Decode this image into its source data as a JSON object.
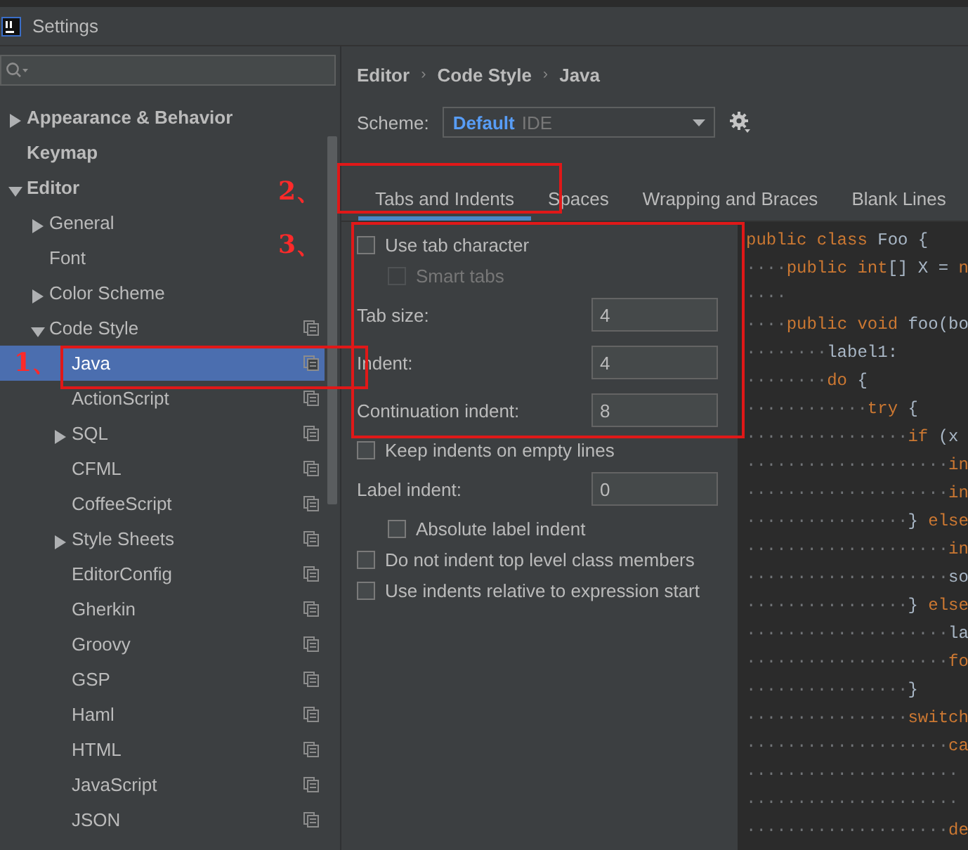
{
  "window": {
    "title": "Settings"
  },
  "sidebar": {
    "items": [
      {
        "label": "Appearance & Behavior",
        "expanded": false
      },
      {
        "label": "Keymap"
      },
      {
        "label": "Editor",
        "expanded": true,
        "children": [
          {
            "label": "General",
            "expanded": false
          },
          {
            "label": "Font"
          },
          {
            "label": "Color Scheme",
            "expanded": false
          },
          {
            "label": "Code Style",
            "expanded": true,
            "scheme_icon": true,
            "children": [
              {
                "label": "Java",
                "selected": true,
                "scheme_icon": true
              },
              {
                "label": "ActionScript",
                "selected": false,
                "scheme_icon": true
              },
              {
                "label": "SQL",
                "selected": false,
                "expanded": false,
                "scheme_icon": true
              },
              {
                "label": "CFML",
                "selected": false,
                "scheme_icon": true
              },
              {
                "label": "CoffeeScript",
                "selected": false,
                "scheme_icon": true
              },
              {
                "label": "Style Sheets",
                "selected": false,
                "expanded": false,
                "scheme_icon": true
              },
              {
                "label": "EditorConfig",
                "selected": false,
                "scheme_icon": true
              },
              {
                "label": "Gherkin",
                "selected": false,
                "scheme_icon": true
              },
              {
                "label": "Groovy",
                "selected": false,
                "scheme_icon": true
              },
              {
                "label": "GSP",
                "selected": false,
                "scheme_icon": true
              },
              {
                "label": "Haml",
                "selected": false,
                "scheme_icon": true
              },
              {
                "label": "HTML",
                "selected": false,
                "scheme_icon": true
              },
              {
                "label": "JavaScript",
                "selected": false,
                "scheme_icon": true
              },
              {
                "label": "JSON",
                "selected": false,
                "scheme_icon": true
              }
            ]
          }
        ]
      }
    ]
  },
  "breadcrumb": [
    {
      "text": "Editor",
      "kind": "crumb"
    },
    {
      "text": "›",
      "kind": "separator"
    },
    {
      "text": "Code Style",
      "kind": "crumb"
    },
    {
      "text": "›",
      "kind": "separator"
    },
    {
      "text": "Java",
      "kind": "crumb"
    }
  ],
  "scheme": {
    "label": "Scheme:",
    "value": "Default",
    "suffix": "IDE"
  },
  "tabs": [
    {
      "label": "Tabs and Indents",
      "selected": true
    },
    {
      "label": "Spaces",
      "selected": false
    },
    {
      "label": "Wrapping and Braces",
      "selected": false
    },
    {
      "label": "Blank Lines",
      "selected": false
    }
  ],
  "options": [
    {
      "kind": "checkbox",
      "label": "Use tab character",
      "checked": false,
      "disabled": false
    },
    {
      "kind": "subcheckbox",
      "label": "Smart tabs",
      "checked": false,
      "disabled": true
    },
    {
      "kind": "number",
      "label": "Tab size:",
      "value": "4"
    },
    {
      "kind": "number",
      "label": "Indent:",
      "value": "4"
    },
    {
      "kind": "number",
      "label": "Continuation indent:",
      "value": "8"
    },
    {
      "kind": "checkbox",
      "label": "Keep indents on empty lines",
      "checked": false,
      "disabled": false
    },
    {
      "kind": "number",
      "label": "Label indent:",
      "value": "0"
    },
    {
      "kind": "subcheckbox",
      "label": "Absolute label indent",
      "checked": false,
      "disabled": false
    },
    {
      "kind": "checkbox",
      "label": "Do not indent top level class members",
      "checked": false,
      "disabled": false
    },
    {
      "kind": "checkbox",
      "label": "Use indents relative to expression start",
      "checked": false,
      "disabled": false
    }
  ],
  "code_lines": [
    {
      "tokens": [
        {
          "text": "public class ",
          "kind": "keyword"
        },
        {
          "text": "Foo {",
          "kind": "plain"
        }
      ]
    },
    {
      "indent": "····",
      "tokens": [
        {
          "text": "public int",
          "kind": "keyword"
        },
        {
          "text": "[] X = ",
          "kind": "plain"
        },
        {
          "text": "n",
          "kind": "keyword"
        }
      ]
    },
    {
      "indent": "····"
    },
    {
      "indent": "····",
      "tokens": [
        {
          "text": "public void ",
          "kind": "keyword"
        },
        {
          "text": "foo(bo",
          "kind": "plain"
        }
      ]
    },
    {
      "indent": "········",
      "tokens": [
        {
          "text": "label1:",
          "kind": "plain"
        }
      ]
    },
    {
      "indent": "········",
      "tokens": [
        {
          "text": "do ",
          "kind": "keyword"
        },
        {
          "text": "{",
          "kind": "plain"
        }
      ]
    },
    {
      "indent": "············",
      "tokens": [
        {
          "text": "try ",
          "kind": "keyword"
        },
        {
          "text": "{",
          "kind": "plain"
        }
      ]
    },
    {
      "indent": "················",
      "tokens": [
        {
          "text": "if ",
          "kind": "keyword"
        },
        {
          "text": "(x",
          "kind": "plain"
        }
      ]
    },
    {
      "indent": "····················",
      "tokens": [
        {
          "text": "in",
          "kind": "keyword"
        }
      ]
    },
    {
      "indent": "····················",
      "tokens": [
        {
          "text": "in",
          "kind": "keyword"
        }
      ]
    },
    {
      "indent": "················",
      "tokens": [
        {
          "text": "} ",
          "kind": "plain"
        },
        {
          "text": "else",
          "kind": "keyword"
        }
      ]
    },
    {
      "indent": "····················",
      "tokens": [
        {
          "text": "in",
          "kind": "keyword"
        }
      ]
    },
    {
      "indent": "····················",
      "tokens": [
        {
          "text": "so",
          "kind": "plain"
        }
      ]
    },
    {
      "indent": "················",
      "tokens": [
        {
          "text": "} ",
          "kind": "plain"
        },
        {
          "text": "else",
          "kind": "keyword"
        }
      ]
    },
    {
      "indent": "····················",
      "tokens": [
        {
          "text": "la",
          "kind": "plain"
        }
      ]
    },
    {
      "indent": "····················",
      "tokens": [
        {
          "text": "fo",
          "kind": "keyword"
        }
      ]
    },
    {
      "indent": "················",
      "tokens": [
        {
          "text": "}",
          "kind": "plain"
        }
      ]
    },
    {
      "indent": "················",
      "tokens": [
        {
          "text": "switch",
          "kind": "keyword"
        }
      ]
    },
    {
      "indent": "····················",
      "tokens": [
        {
          "text": "ca",
          "kind": "keyword"
        }
      ]
    },
    {
      "indent": "·····················"
    },
    {
      "indent": "·····················"
    },
    {
      "indent": "····················",
      "tokens": [
        {
          "text": "de",
          "kind": "keyword"
        }
      ]
    }
  ],
  "annotations": [
    {
      "text": "1、"
    },
    {
      "text": "2、"
    },
    {
      "text": "3、"
    }
  ]
}
